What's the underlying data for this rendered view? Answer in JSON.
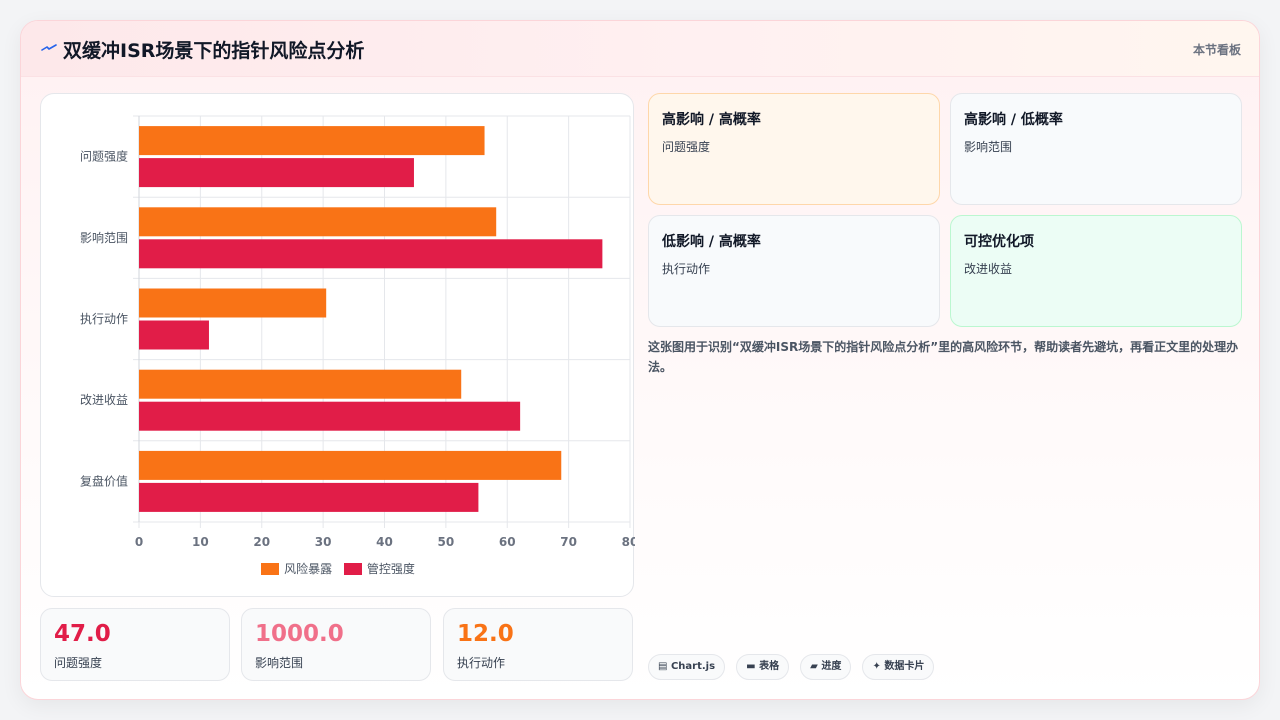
{
  "header": {
    "title": "双缓冲ISR场景下的指针风险点分析",
    "right_label": "本节看板",
    "icon": "lightning-icon"
  },
  "chart_data": {
    "type": "bar",
    "orientation": "horizontal",
    "categories": [
      "问题强度",
      "影响范围",
      "执行动作",
      "改进收益",
      "复盘价值"
    ],
    "series": [
      {
        "name": "风险暴露",
        "color": "#f97316",
        "values": [
          56.3,
          58.2,
          30.5,
          52.5,
          68.8
        ]
      },
      {
        "name": "管控强度",
        "color": "#e11d48",
        "values": [
          44.8,
          75.5,
          11.4,
          62.1,
          55.3
        ]
      }
    ],
    "xlim": [
      0,
      80
    ],
    "xticks": [
      0,
      10,
      20,
      30,
      40,
      50,
      60,
      70,
      80
    ],
    "grid": true,
    "legend_position": "bottom"
  },
  "stats": [
    {
      "value": "47.0",
      "label": "问题强度",
      "color": "#e11d48"
    },
    {
      "value": "1000.0",
      "label": "影响范围",
      "color": "#f0708a"
    },
    {
      "value": "12.0",
      "label": "执行动作",
      "color": "#f97316"
    }
  ],
  "quadrants": [
    {
      "title": "高影响 / 高概率",
      "body": "问题强度",
      "bg": "#fff7ed",
      "border": "#fed7aa"
    },
    {
      "title": "高影响 / 低概率",
      "body": "影响范围",
      "bg": "#f8fafc",
      "border": "#e2e8f0"
    },
    {
      "title": "低影响 / 高概率",
      "body": "执行动作",
      "bg": "#f8fafc",
      "border": "#e2e8f0"
    },
    {
      "title": "可控优化项",
      "body": "改进收益",
      "bg": "#ecfdf5",
      "border": "#bbf7d0"
    }
  ],
  "description": "这张图用于识别“双缓冲ISR场景下的指针风险点分析”里的高风险环节，帮助读者先避坑，再看正文里的处理办法。",
  "tags": [
    {
      "icon": "chart-icon",
      "glyph": "▤",
      "label": "Chart.js"
    },
    {
      "icon": "table-icon",
      "glyph": "▬",
      "label": "表格"
    },
    {
      "icon": "progress-icon",
      "glyph": "▰",
      "label": "进度"
    },
    {
      "icon": "sparkle-icon",
      "glyph": "✦",
      "label": "数据卡片"
    }
  ]
}
